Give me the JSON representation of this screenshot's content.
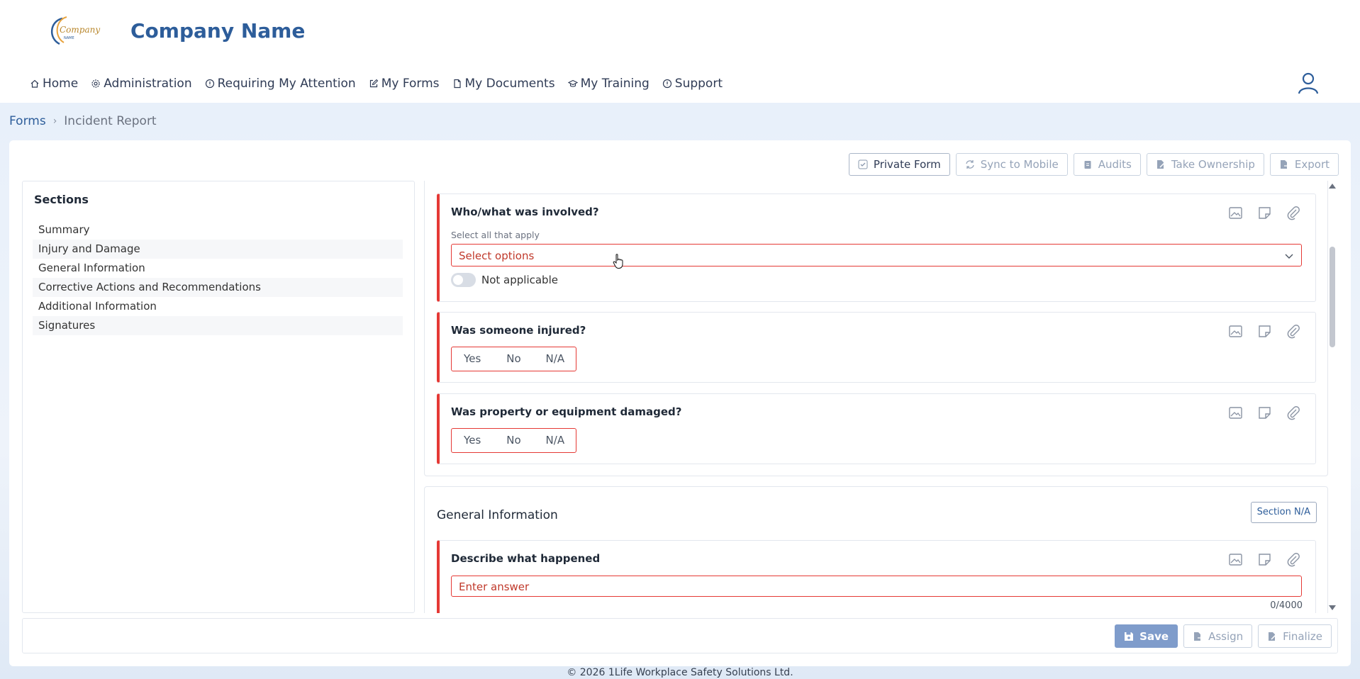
{
  "app": {
    "company_name": "Company Name",
    "logo_text": "Company",
    "logo_subtext": "NAME"
  },
  "nav": [
    {
      "label": "Home",
      "icon": "home-icon"
    },
    {
      "label": "Administration",
      "icon": "gear-icon"
    },
    {
      "label": "Requiring My Attention",
      "icon": "alert-circle-icon"
    },
    {
      "label": "My Forms",
      "icon": "edit-icon"
    },
    {
      "label": "My Documents",
      "icon": "document-icon"
    },
    {
      "label": "My Training",
      "icon": "graduation-cap-icon"
    },
    {
      "label": "Support",
      "icon": "info-circle-icon"
    }
  ],
  "breadcrumb": {
    "root": "Forms",
    "current": "Incident Report"
  },
  "toolbar": {
    "private_form": "Private Form",
    "sync_to_mobile": "Sync to Mobile",
    "audits": "Audits",
    "take_ownership": "Take Ownership",
    "export": "Export"
  },
  "sections": {
    "title": "Sections",
    "items": [
      "Summary",
      "Injury and Damage",
      "General Information",
      "Corrective Actions and Recommendations",
      "Additional Information",
      "Signatures"
    ]
  },
  "questions": {
    "involved": {
      "title": "Who/what was involved?",
      "hint": "Select all that apply",
      "placeholder": "Select options",
      "not_applicable": "Not applicable"
    },
    "injured": {
      "title": "Was someone injured?",
      "options": [
        "Yes",
        "No",
        "N/A"
      ]
    },
    "damaged": {
      "title": "Was property or equipment damaged?",
      "options": [
        "Yes",
        "No",
        "N/A"
      ]
    }
  },
  "general_information": {
    "title": "General Information",
    "section_na": "Section N/A",
    "describe": {
      "title": "Describe what happened",
      "placeholder": "Enter answer",
      "counter": "0/4000"
    }
  },
  "footer": {
    "save": "Save",
    "assign": "Assign",
    "finalize": "Finalize",
    "copyright": "© 2026 1Life Workplace Safety Solutions Ltd."
  },
  "colors": {
    "brand": "#2d5d9a",
    "required": "#e53935",
    "primary_button": "#7f9ccb"
  }
}
